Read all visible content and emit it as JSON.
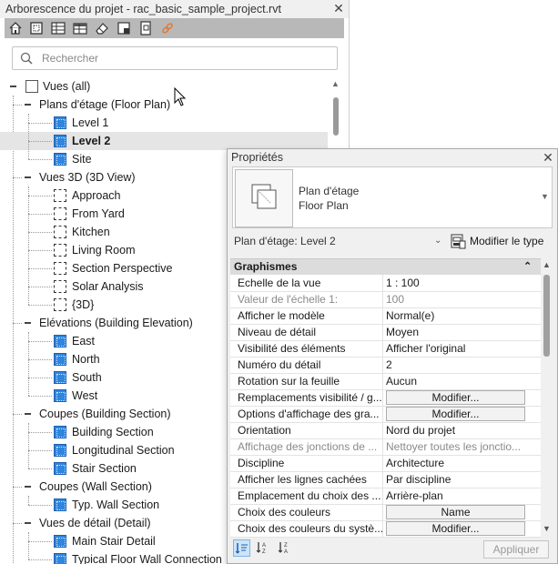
{
  "project_browser": {
    "title": "Arborescence du projet - rac_basic_sample_project.rvt",
    "close_glyph": "✕",
    "search_placeholder": "Rechercher",
    "toolbar_icons": [
      "home-icon",
      "zoom-extents-icon",
      "schedule-icon",
      "table-icon",
      "eraser-icon",
      "sheet-icon",
      "copy-view-icon",
      "link-icon"
    ],
    "tree": {
      "root": "Vues (all)",
      "groups": [
        {
          "label": "Plans d'étage (Floor Plan)",
          "items": [
            "Level 1",
            "Level 2",
            "Site"
          ],
          "selected": "Level 2",
          "icon": "plan-view-icon"
        },
        {
          "label": "Vues 3D (3D View)",
          "items": [
            "Approach",
            "From Yard",
            "Kitchen",
            "Living Room",
            "Section Perspective",
            "Solar Analysis",
            "{3D}"
          ],
          "icon": "3d-view-icon"
        },
        {
          "label": "Elévations (Building Elevation)",
          "items": [
            "East",
            "North",
            "South",
            "West"
          ],
          "icon": "elevation-view-icon"
        },
        {
          "label": "Coupes (Building Section)",
          "items": [
            "Building Section",
            "Longitudinal Section",
            "Stair Section"
          ],
          "icon": "section-view-icon"
        },
        {
          "label": "Coupes (Wall Section)",
          "items": [
            "Typ. Wall Section"
          ],
          "icon": "section-view-icon"
        },
        {
          "label": "Vues de détail (Detail)",
          "items": [
            "Main Stair Detail",
            "Typical Floor Wall Connection"
          ],
          "icon": "detail-view-icon"
        }
      ]
    }
  },
  "properties": {
    "title": "Propriétés",
    "close_glyph": "✕",
    "type_line1": "Plan d'étage",
    "type_line2": "Floor Plan",
    "instance_selector": "Plan d'étage: Level 2",
    "edit_type_label": "Modifier le type",
    "group_header": "Graphismes",
    "rows": [
      {
        "name": "Echelle de la vue",
        "value": "1 : 100"
      },
      {
        "name": "Valeur de l'échelle    1:",
        "value": "100",
        "disabled": true
      },
      {
        "name": "Afficher le modèle",
        "value": "Normal(e)"
      },
      {
        "name": "Niveau de détail",
        "value": "Moyen"
      },
      {
        "name": "Visibilité des éléments",
        "value": "Afficher l'original"
      },
      {
        "name": "Numéro du détail",
        "value": "2"
      },
      {
        "name": "Rotation sur la feuille",
        "value": "Aucun"
      },
      {
        "name": "Remplacements visibilité / g...",
        "button": "Modifier..."
      },
      {
        "name": "Options d'affichage des gra...",
        "button": "Modifier..."
      },
      {
        "name": "Orientation",
        "value": "Nord du projet"
      },
      {
        "name": "Affichage des jonctions de ...",
        "value": "Nettoyer toutes les jonctio...",
        "disabled": true
      },
      {
        "name": "Discipline",
        "value": "Architecture"
      },
      {
        "name": "Afficher les lignes cachées",
        "value": "Par discipline"
      },
      {
        "name": "Emplacement du choix des ...",
        "value": "Arrière-plan"
      },
      {
        "name": "Choix des couleurs",
        "button": "Name"
      },
      {
        "name": "Choix des couleurs du systè...",
        "button": "Modifier..."
      }
    ],
    "apply_label": "Appliquer"
  }
}
